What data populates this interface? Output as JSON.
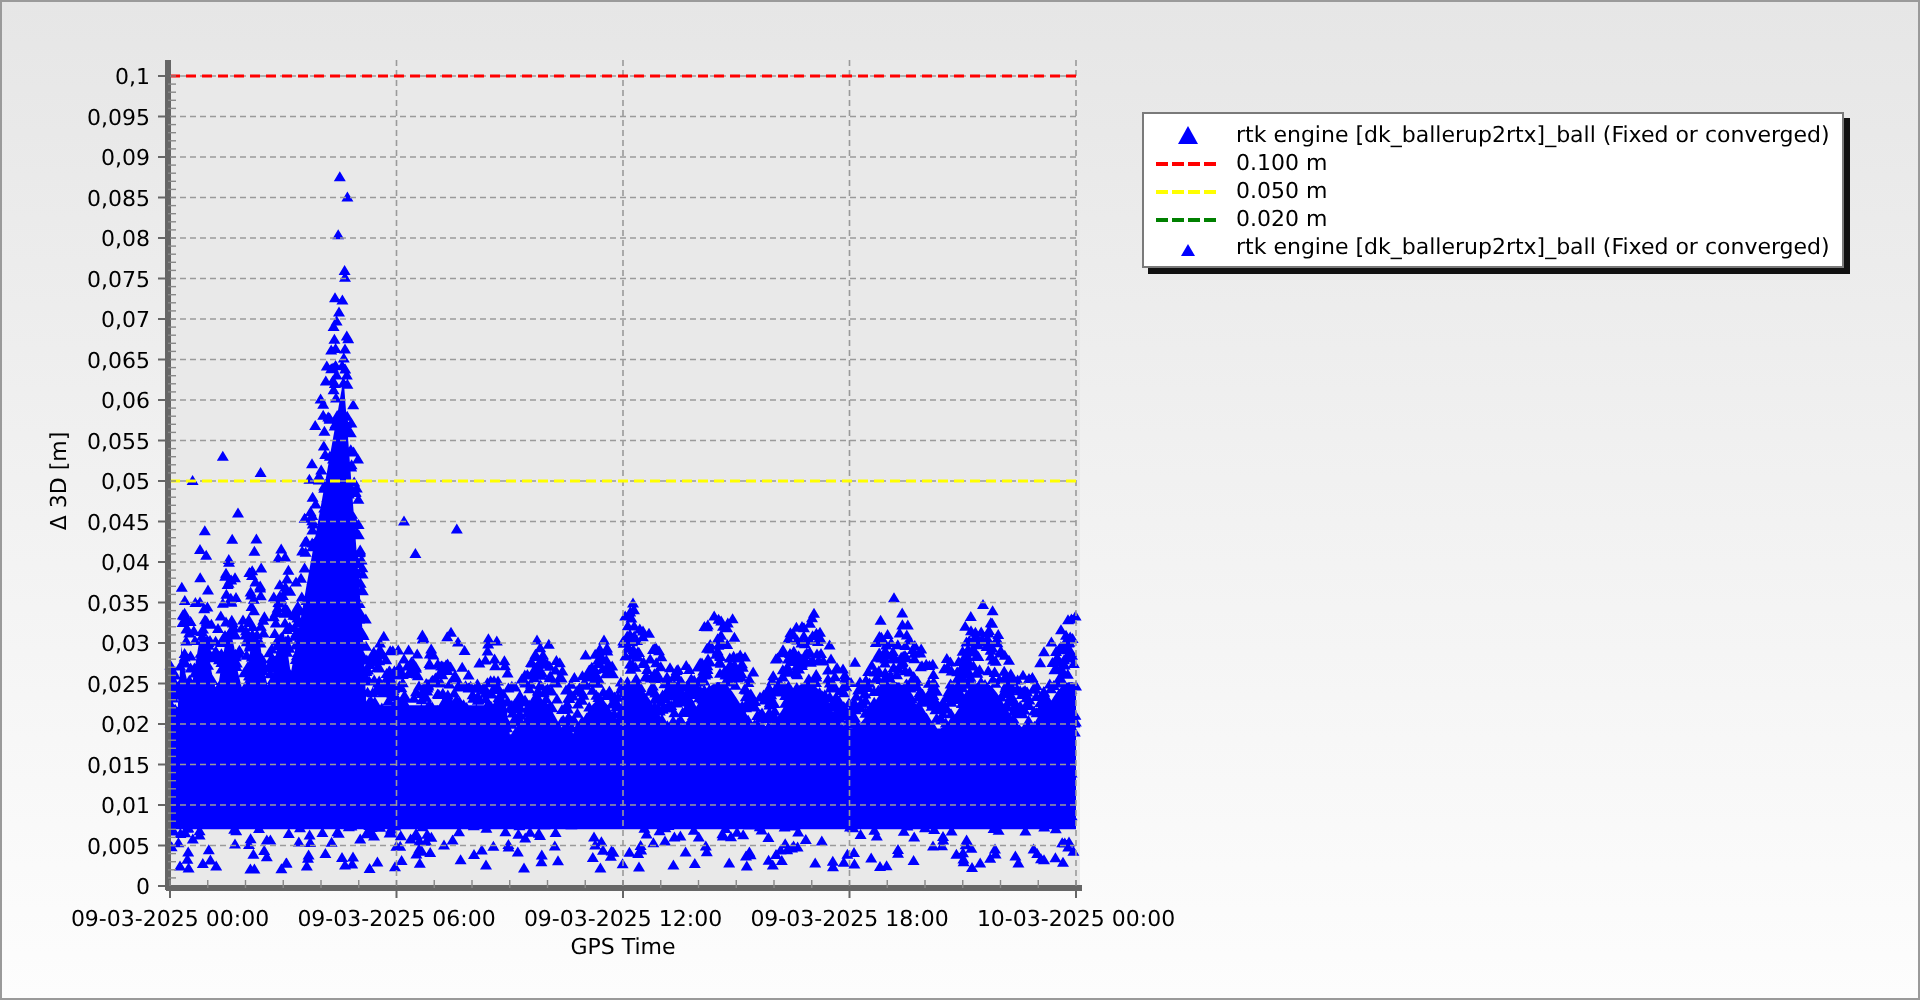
{
  "chart_data": {
    "type": "line",
    "grid": true,
    "xlabel": "GPS Time",
    "ylabel": "Δ 3D [m]",
    "categories": [
      "09-03-2025 00:00",
      "09-03-2025 06:00",
      "09-03-2025 12:00",
      "09-03-2025 18:00",
      "10-03-2025 00:00"
    ],
    "ylim": [
      0,
      0.1
    ],
    "yticks": [
      {
        "value": 0,
        "label": "0"
      },
      {
        "value": 0.005,
        "label": "0,005"
      },
      {
        "value": 0.01,
        "label": "0,01"
      },
      {
        "value": 0.015,
        "label": "0,015"
      },
      {
        "value": 0.02,
        "label": "0,02"
      },
      {
        "value": 0.025,
        "label": "0,025"
      },
      {
        "value": 0.03,
        "label": "0,03"
      },
      {
        "value": 0.035,
        "label": "0,035"
      },
      {
        "value": 0.04,
        "label": "0,04"
      },
      {
        "value": 0.045,
        "label": "0,045"
      },
      {
        "value": 0.05,
        "label": "0,05"
      },
      {
        "value": 0.055,
        "label": "0,055"
      },
      {
        "value": 0.06,
        "label": "0,06"
      },
      {
        "value": 0.065,
        "label": "0,065"
      },
      {
        "value": 0.07,
        "label": "0,07"
      },
      {
        "value": 0.075,
        "label": "0,075"
      },
      {
        "value": 0.08,
        "label": "0,08"
      },
      {
        "value": 0.085,
        "label": "0,085"
      },
      {
        "value": 0.09,
        "label": "0,09"
      },
      {
        "value": 0.095,
        "label": "0,095"
      },
      {
        "value": 0.1,
        "label": "0,1"
      }
    ],
    "series": [
      {
        "color": "#ffff00",
        "line_style": "dashed",
        "values": [
          0.05,
          0.05,
          0.05,
          0.05,
          0.05
        ]
      },
      {
        "color": "#ff0000",
        "line_style": "dashed",
        "values": [
          0.1,
          0.1,
          0.1,
          0.1,
          0.1
        ]
      }
    ]
  },
  "legend": [
    {
      "kind": "marker",
      "label": "rtk engine [dk_ballerup2rtx]_ball (Fixed or converged)",
      "color": "#0000ff"
    },
    {
      "kind": "line",
      "label": "0.100 m",
      "color": "#ff0000"
    },
    {
      "kind": "line",
      "label": "0.050 m",
      "color": "#ffff00"
    },
    {
      "kind": "line",
      "label": "0.020 m",
      "color": "#008000"
    },
    {
      "kind": "small-marker",
      "label": "rtk engine [dk_ballerup2rtx]_ball (Fixed or converged)",
      "color": "#0000ff"
    }
  ]
}
